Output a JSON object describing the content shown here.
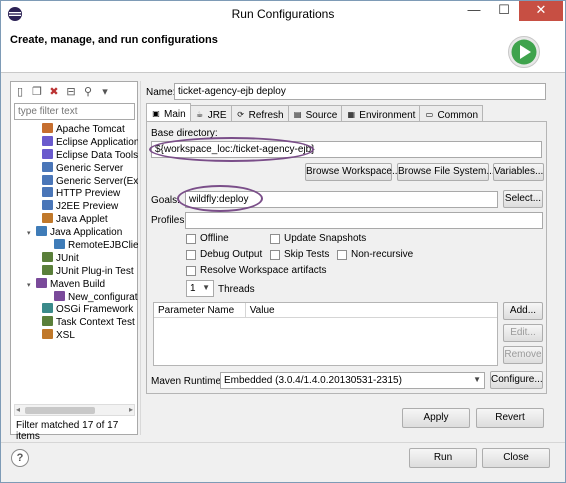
{
  "window": {
    "title": "Run Configurations",
    "minimize": "—",
    "maximize": "☐",
    "close": "✕"
  },
  "header": {
    "title": "Create, manage, and run configurations"
  },
  "left": {
    "filter_placeholder": "type filter text",
    "tree": [
      {
        "label": "Apache Tomcat",
        "level": 1,
        "color": "#c66e2f"
      },
      {
        "label": "Eclipse Application",
        "level": 1,
        "color": "#6a5acd"
      },
      {
        "label": "Eclipse Data Tools",
        "level": 1,
        "color": "#6a5acd"
      },
      {
        "label": "Generic Server",
        "level": 1,
        "color": "#4a76b8"
      },
      {
        "label": "Generic Server(Externa",
        "level": 1,
        "color": "#4a76b8"
      },
      {
        "label": "HTTP Preview",
        "level": 1,
        "color": "#4a76b8"
      },
      {
        "label": "J2EE Preview",
        "level": 1,
        "color": "#4a76b8"
      },
      {
        "label": "Java Applet",
        "level": 1,
        "color": "#c0782a"
      },
      {
        "label": "Java Application",
        "level": 0,
        "color": "#3f7cb8",
        "twisty": "▾"
      },
      {
        "label": "RemoteEJBClient",
        "level": 2,
        "color": "#3f7cb8"
      },
      {
        "label": "JUnit",
        "level": 1,
        "color": "#5a7f3a"
      },
      {
        "label": "JUnit Plug-in Test",
        "level": 1,
        "color": "#5a7f3a"
      },
      {
        "label": "Maven Build",
        "level": 0,
        "color": "#7a4a9a",
        "twisty": "▾"
      },
      {
        "label": "New_configuratio",
        "level": 2,
        "color": "#7a4a9a"
      },
      {
        "label": "OSGi Framework",
        "level": 1,
        "color": "#3a8a8a"
      },
      {
        "label": "Task Context Test",
        "level": 1,
        "color": "#5a7f3a"
      },
      {
        "label": "XSL",
        "level": 1,
        "color": "#c0782a"
      }
    ],
    "status": "Filter matched 17 of 17 items"
  },
  "config": {
    "name_label": "Name:",
    "name_value": "ticket-agency-ejb deploy",
    "tabs": [
      {
        "label": "Main",
        "icon": "m2"
      },
      {
        "label": "JRE",
        "icon": "jre"
      },
      {
        "label": "Refresh",
        "icon": "refresh"
      },
      {
        "label": "Source",
        "icon": "source"
      },
      {
        "label": "Environment",
        "icon": "env"
      },
      {
        "label": "Common",
        "icon": "common"
      }
    ],
    "base_dir_label": "Base directory:",
    "base_dir_value": "${workspace_loc:/ticket-agency-ejb}",
    "browse_workspace": "Browse Workspace...",
    "browse_fs": "Browse File System...",
    "variables": "Variables...",
    "goals_label": "Goals:",
    "goals_value": "wildfly:deploy",
    "select": "Select...",
    "profiles_label": "Profiles:",
    "checks": {
      "offline": "Offline",
      "update_snapshots": "Update Snapshots",
      "debug_output": "Debug Output",
      "skip_tests": "Skip Tests",
      "non_recursive": "Non-recursive",
      "resolve_ws": "Resolve Workspace artifacts"
    },
    "threads_value": "1",
    "threads_label": "Threads",
    "table": {
      "col_name": "Parameter Name",
      "col_value": "Value"
    },
    "add": "Add...",
    "edit": "Edit...",
    "remove": "Remove",
    "runtime_label": "Maven Runtime:",
    "runtime_value": "Embedded (3.0.4/1.4.0.20130531-2315)",
    "configure": "Configure...",
    "apply": "Apply",
    "revert": "Revert"
  },
  "footer": {
    "help": "?",
    "run": "Run",
    "close": "Close"
  },
  "colors": {
    "accent_ellipse": "#7a4e89",
    "run_logo": "#3fa34d"
  }
}
